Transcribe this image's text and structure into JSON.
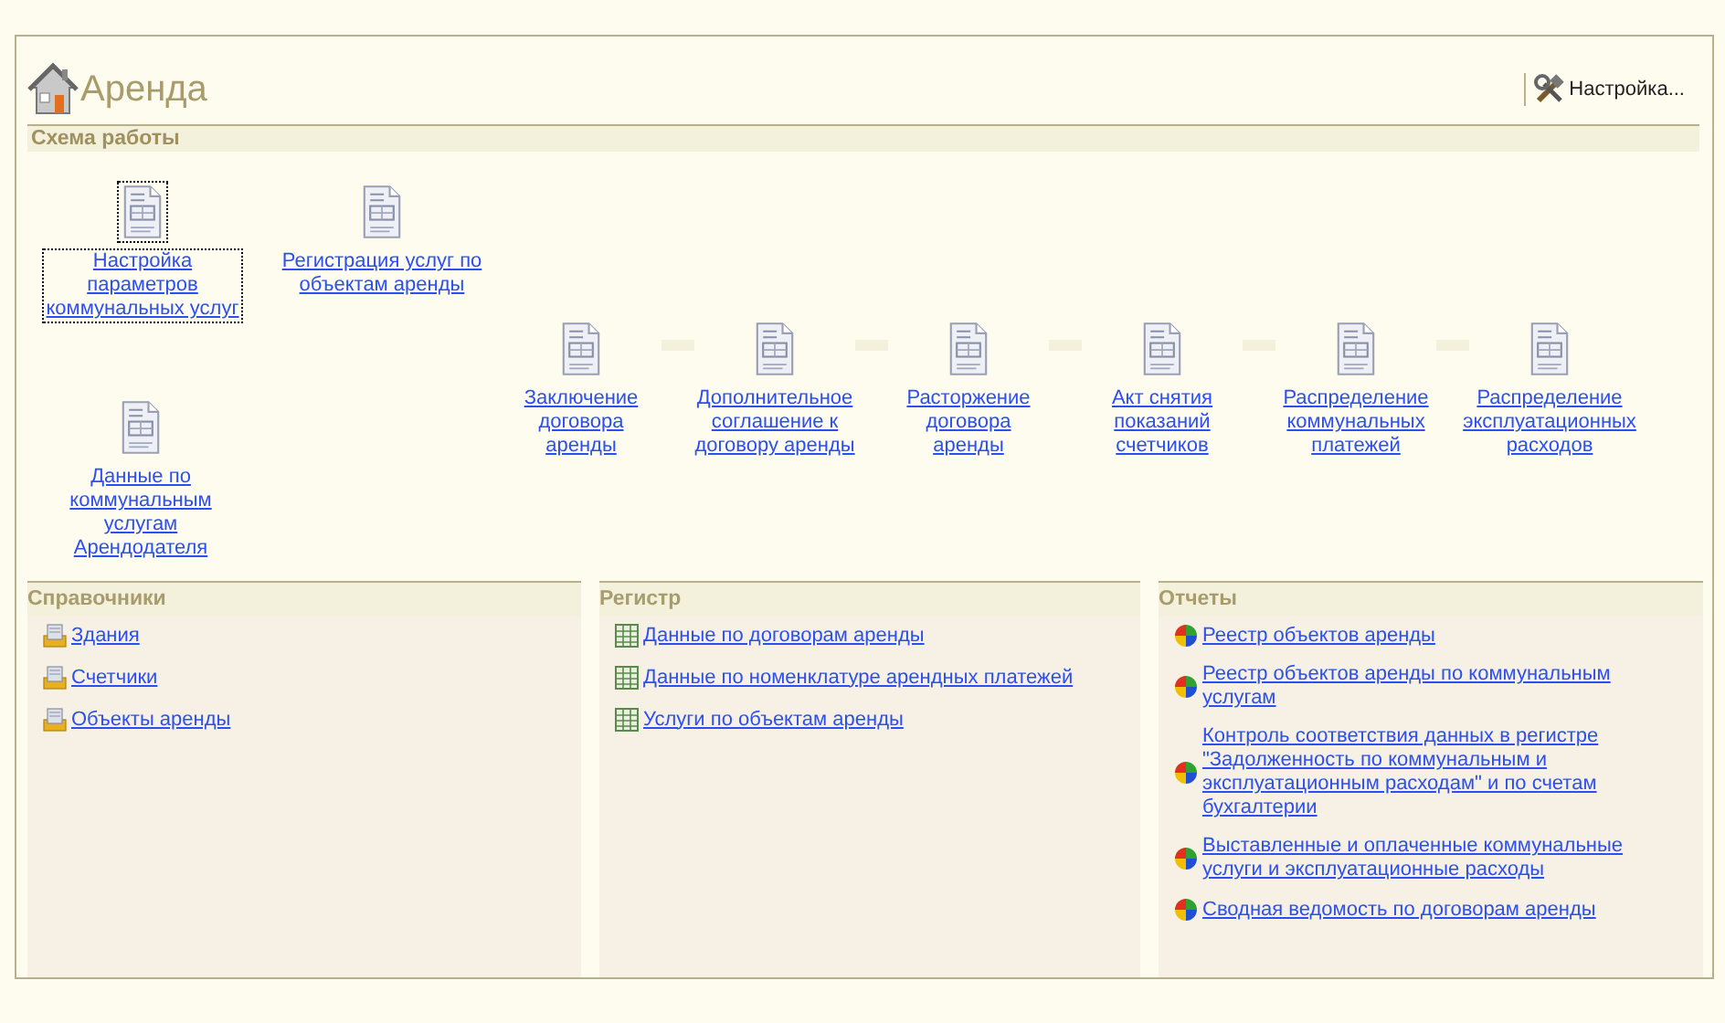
{
  "header": {
    "title": "Аренда",
    "settings_button": "Настройка..."
  },
  "scheme": {
    "title": "Схема работы",
    "nodes": [
      {
        "label": "Настройка параметров коммунальных услуг",
        "focused": true
      },
      {
        "label": "Регистрация услуг по объектам аренды",
        "focused": false
      },
      {
        "label": "Данные по коммунальным услугам Арендодателя",
        "focused": false
      }
    ],
    "chain": [
      {
        "label": "Заключение договора аренды",
        "focused": false
      },
      {
        "label": "Дополнительное соглашение к договору аренды",
        "focused": false
      },
      {
        "label": "Расторжение договора аренды",
        "focused": false
      },
      {
        "label": "Акт снятия показаний счетчиков",
        "focused": false
      },
      {
        "label": "Распределение коммунальных платежей",
        "focused": false
      },
      {
        "label": "Распределение эксплуатационных расходов",
        "focused": false
      }
    ]
  },
  "panels": [
    {
      "title": "Справочники",
      "kind": "catalog",
      "items": [
        "Здания",
        "Счетчики",
        "Объекты аренды"
      ]
    },
    {
      "title": "Регистр",
      "kind": "register",
      "items": [
        "Данные по договорам аренды",
        "Данные по номенклатуре арендных платежей",
        "Услуги по объектам аренды"
      ]
    },
    {
      "title": "Отчеты",
      "kind": "report",
      "items": [
        "Реестр объектов аренды",
        "Реестр объектов аренды по коммунальным услугам",
        "Контроль соответствия данных в регистре \"Задолженность по коммунальным и эксплуатационным расходам\" и  по счетам бухгалтерии",
        "Выставленные и оплаченные коммунальные услуги и эксплуатационные расходы",
        "Сводная ведомость по договорам аренды"
      ]
    }
  ]
}
